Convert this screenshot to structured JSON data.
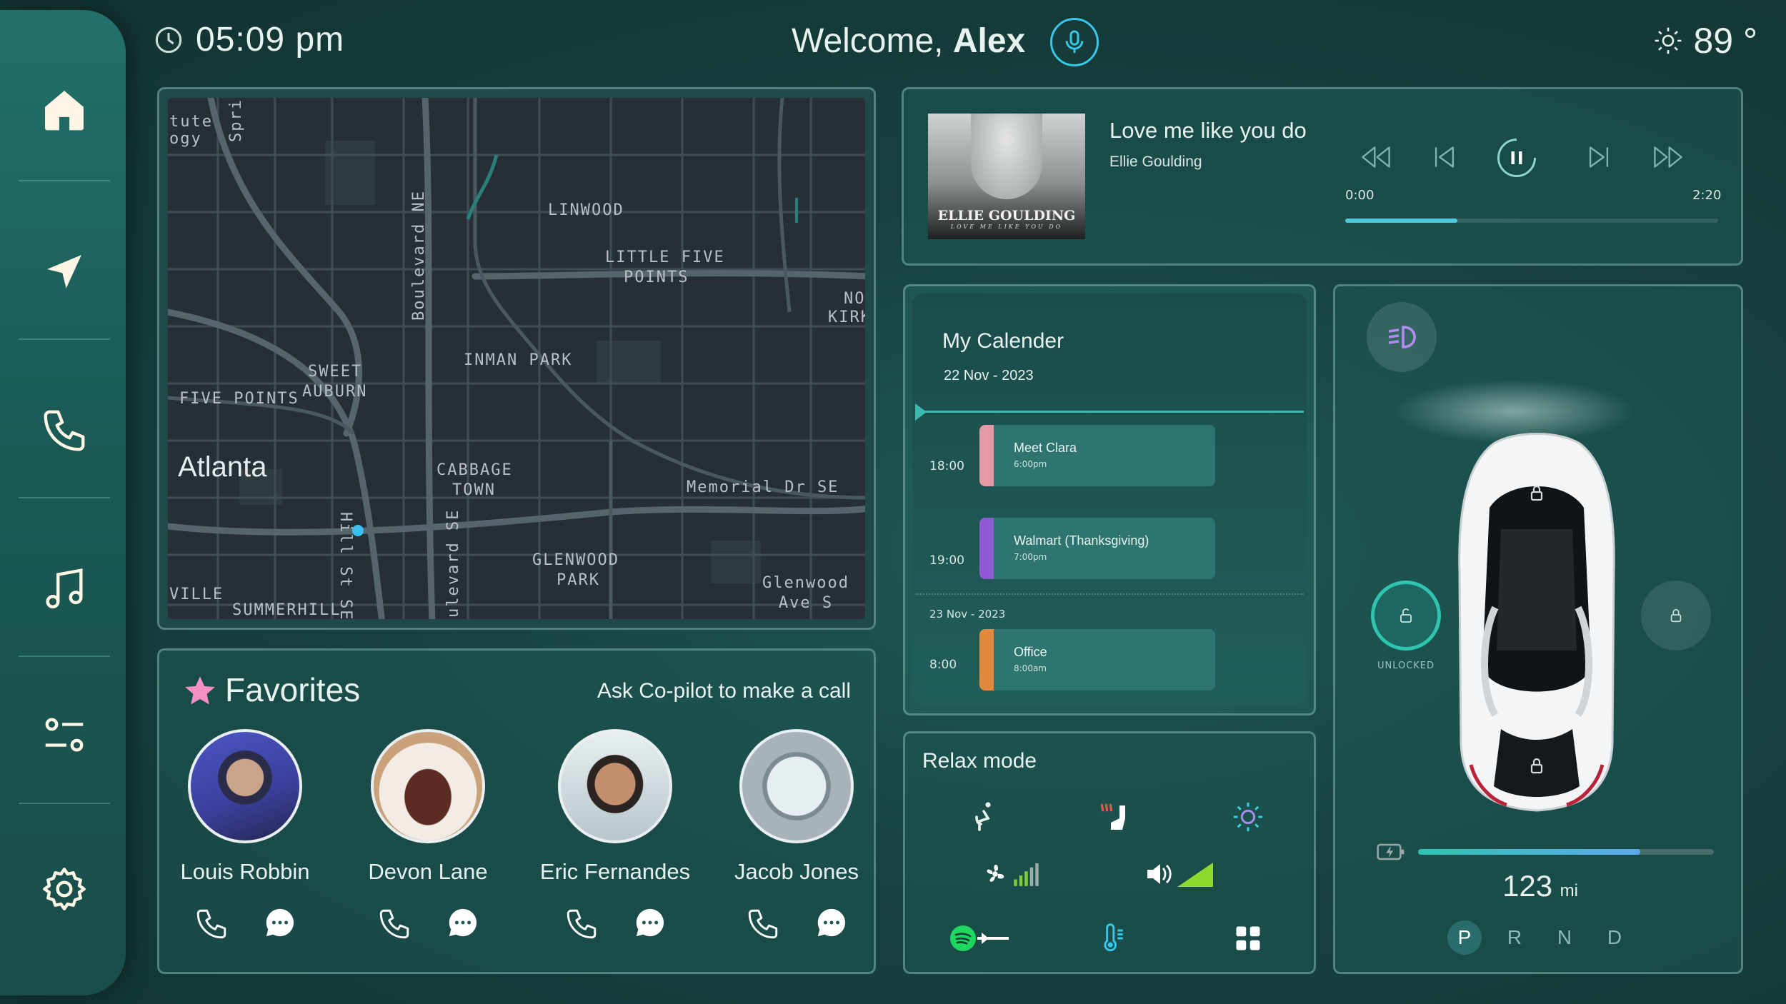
{
  "header": {
    "time": "05:09 pm",
    "welcome_prefix": "Welcome,",
    "user_name": "Alex",
    "temperature": "89 °"
  },
  "sidebar": {
    "items": [
      {
        "icon": "home-icon"
      },
      {
        "icon": "navigation-icon"
      },
      {
        "icon": "phone-icon"
      },
      {
        "icon": "music-icon"
      },
      {
        "icon": "controls-icon"
      },
      {
        "icon": "settings-icon"
      }
    ]
  },
  "map": {
    "labels": [
      "tute",
      "ogy",
      "Spring",
      "LINWOOD",
      "Boulevard NE",
      "LITTLE FIVE",
      "POINTS",
      "NO",
      "KIRK",
      "INMAN PARK",
      "SWEET",
      "AUBURN",
      "FIVE POINTS",
      "Atlanta",
      "CABBAGE",
      "TOWN",
      "Memorial Dr SE",
      "Hill St SE",
      "ulevard SE",
      "GLENWOOD",
      "PARK",
      "Glenwood Ave S",
      "VILLE",
      "SUMMERHILL"
    ]
  },
  "favorites": {
    "title": "Favorites",
    "hint": "Ask Co-pilot to make a call",
    "contacts": [
      {
        "name": "Louis Robbin"
      },
      {
        "name": "Devon Lane"
      },
      {
        "name": "Eric Fernandes"
      },
      {
        "name": "Jacob Jones"
      }
    ]
  },
  "music": {
    "song": "Love me like you do",
    "artist": "Ellie Goulding",
    "album_artist": "ELLIE GOULDING",
    "album_subtitle": "LOVE ME LIKE YOU DO",
    "elapsed": "0:00",
    "duration": "2:20",
    "progress": 0.3
  },
  "calendar": {
    "title": "My Calender",
    "date": "22 Nov - 2023",
    "events": [
      {
        "time": "18:00",
        "title": "Meet Clara",
        "sub": "6:00pm",
        "color": "#e39aa6"
      },
      {
        "time": "19:00",
        "title": "Walmart (Thanksgiving)",
        "sub": "7:00pm",
        "color": "#8e5ad1"
      }
    ],
    "next_date": "23 Nov - 2023",
    "next_events": [
      {
        "time": "8:00",
        "title": "Office",
        "sub": "8:00am",
        "color": "#e08a3c"
      }
    ]
  },
  "relax": {
    "title": "Relax mode"
  },
  "vehicle": {
    "unlock_label": "UNLOCKED",
    "range_value": "123",
    "range_unit": "mi",
    "battery_level": 0.75,
    "gears": [
      "P",
      "R",
      "N",
      "D"
    ],
    "active_gear": "P"
  },
  "colors": {
    "accent": "#38c7e8",
    "teal": "#2ec4b0",
    "favorite_star": "#f490c6"
  }
}
